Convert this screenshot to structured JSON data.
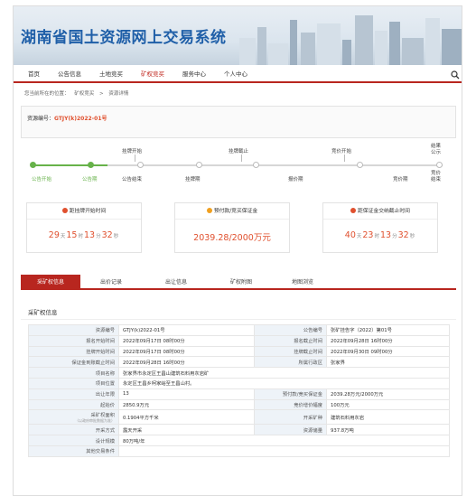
{
  "banner": {
    "title": "湖南省国土资源网上交易系统"
  },
  "nav": {
    "items": [
      "首页",
      "公告信息",
      "土地竞买",
      "矿权竞买",
      "服务中心",
      "个人中心"
    ]
  },
  "breadcrumb": {
    "prefix": "您当前所在的位置：",
    "level1": "矿权竞买",
    "sep": ">",
    "level2": "资源详情"
  },
  "resource": {
    "code_label": "资源编号：",
    "code": "GTJY(k)2022-01号"
  },
  "timeline": {
    "top": [
      "挂牌开始",
      "挂牌截止",
      "竞价开始",
      "结果公示"
    ],
    "bottom": [
      "公告开始",
      "公告期",
      "公告结束",
      "挂牌期",
      "报价期",
      "竞价期",
      "竞价结束"
    ]
  },
  "stats": {
    "countdown": {
      "label": "距挂牌开始时间",
      "d": "29",
      "h": "15",
      "m": "13",
      "s": "32",
      "u_d": "天",
      "u_h": "时",
      "u_m": "分",
      "u_s": "秒"
    },
    "deposit": {
      "label": "预付款/竞买保证金",
      "value": "2039.28/2000万元"
    },
    "deadline": {
      "label": "距保证金交纳截止时间",
      "d": "40",
      "h": "23",
      "m": "13",
      "s": "32",
      "u_d": "天",
      "u_h": "时",
      "u_m": "分",
      "u_s": "秒"
    }
  },
  "tabs": [
    "采矿权信息",
    "出价记录",
    "出让信息",
    "矿权附图",
    "地图浏览"
  ],
  "section_title": "采矿权信息",
  "info": {
    "rows": [
      [
        "资源编号",
        "GTJY(k)2022-01号",
        "公告编号",
        "张矿挂告字（2022）第01号"
      ],
      [
        "报名开始时间",
        "2022年09月17日 08时00分",
        "报名截止时间",
        "2022年09月28日 16时00分"
      ],
      [
        "挂牌开始时间",
        "2022年09月17日 08时00分",
        "挂牌截止时间",
        "2022年09月30日 09时00分"
      ],
      [
        "保证金到账截止时间",
        "2022年09月28日 16时00分",
        "所属行政区",
        "张家界"
      ],
      [
        "项目名称",
        "张家界市永定区王昌山建筑石料用灰岩矿",
        "",
        ""
      ],
      [
        "项目位置",
        "永定区王昌乡柯家峪至王昌山村。",
        "",
        ""
      ],
      [
        "出让年限",
        "13",
        "预付款/竞买保证金",
        "2039.28万元/2000万元"
      ],
      [
        "起始价",
        "2850.9万元",
        "竞价增价幅度",
        "100万元"
      ],
      [
        "采矿权面积",
        "0.1904平方千米",
        "开采矿种",
        "建筑石料用灰岩"
      ],
      [
        "开采方式",
        "露天开采",
        "资源储量",
        "937.8万吨"
      ],
      [
        "设计规模",
        "80万吨/年",
        "",
        ""
      ],
      [
        "其他交易条件",
        "",
        "",
        ""
      ]
    ],
    "area_sub": "（以政府审批数据为准）"
  },
  "colors": {
    "brand_red": "#b8261f",
    "accent_orange": "#e0502e",
    "progress_green": "#67b24a",
    "title_blue": "#1f5fa8"
  }
}
